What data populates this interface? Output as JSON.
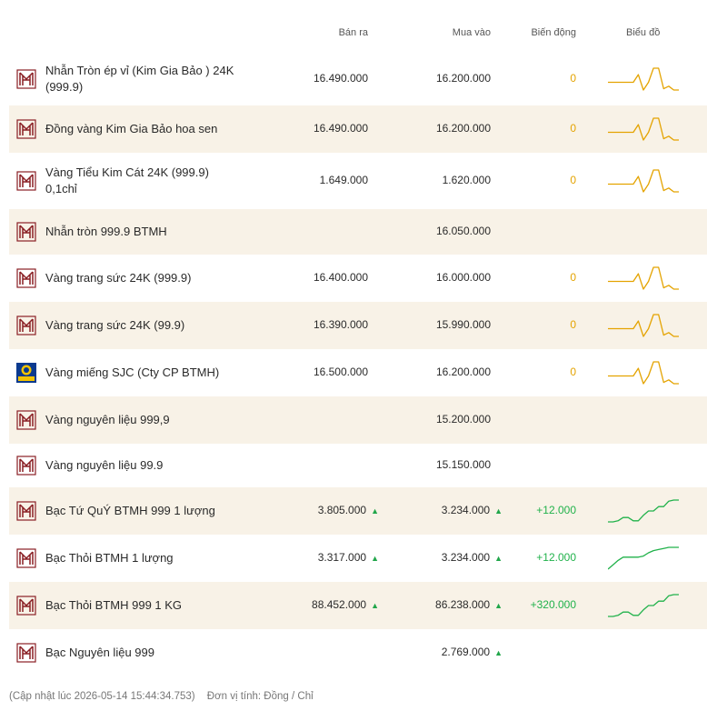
{
  "header": {
    "sell": "Bán ra",
    "buy": "Mua vào",
    "change": "Biến động",
    "chart": "Biểu đồ"
  },
  "colors": {
    "zero": "#e4a300",
    "positive": "#21b24b",
    "alt_row": "#f8f2e7",
    "brand": "#8a1f24"
  },
  "rows": [
    {
      "name": "Nhẫn Tròn ép vỉ (Kim Gia Bảo ) 24K (999.9)",
      "sell": "16.490.000",
      "buy": "16.200.000",
      "change": "0",
      "trend": "flat",
      "logo": "btmh-logo"
    },
    {
      "name": "Đồng vàng Kim Gia Bảo hoa sen",
      "sell": "16.490.000",
      "buy": "16.200.000",
      "change": "0",
      "trend": "flat",
      "logo": "btmh-logo"
    },
    {
      "name": "Vàng Tiểu Kim Cát 24K (999.9) 0,1chỉ",
      "sell": "1.649.000",
      "buy": "1.620.000",
      "change": "0",
      "trend": "flat",
      "logo": "btmh-logo"
    },
    {
      "name": "Nhẫn tròn 999.9 BTMH",
      "sell": "",
      "buy": "16.050.000",
      "change": "",
      "trend": "",
      "logo": "btmh-logo"
    },
    {
      "name": "Vàng trang sức 24K (999.9)",
      "sell": "16.400.000",
      "buy": "16.000.000",
      "change": "0",
      "trend": "flat",
      "logo": "btmh-logo"
    },
    {
      "name": "Vàng trang sức 24K (99.9)",
      "sell": "16.390.000",
      "buy": "15.990.000",
      "change": "0",
      "trend": "flat",
      "logo": "btmh-logo"
    },
    {
      "name": "Vàng miếng SJC (Cty CP BTMH)",
      "sell": "16.500.000",
      "buy": "16.200.000",
      "change": "0",
      "trend": "flat",
      "logo": "sjc-logo"
    },
    {
      "name": "Vàng nguyên liệu 999,9",
      "sell": "",
      "buy": "15.200.000",
      "change": "",
      "trend": "",
      "logo": "btmh-logo"
    },
    {
      "name": "Vàng nguyên liệu 99.9",
      "sell": "",
      "buy": "15.150.000",
      "change": "",
      "trend": "",
      "logo": "btmh-logo"
    },
    {
      "name": "Bạc Tứ QuÝ BTMH 999 1 lượng",
      "sell": "3.805.000",
      "buy": "3.234.000",
      "change": "+12.000",
      "trend": "up",
      "logo": "btmh-logo",
      "sell_up": true,
      "buy_up": true
    },
    {
      "name": "Bạc Thỏi BTMH 1 lượng",
      "sell": "3.317.000",
      "buy": "3.234.000",
      "change": "+12.000",
      "trend": "up2",
      "logo": "btmh-logo",
      "sell_up": true,
      "buy_up": true
    },
    {
      "name": "Bạc Thỏi BTMH 999 1 KG",
      "sell": "88.452.000",
      "buy": "86.238.000",
      "change": "+320.000",
      "trend": "up",
      "logo": "btmh-logo",
      "sell_up": true,
      "buy_up": true
    },
    {
      "name": "Bạc Nguyên liệu 999",
      "sell": "",
      "buy": "2.769.000",
      "change": "",
      "trend": "",
      "logo": "btmh-logo",
      "buy_up": true
    }
  ],
  "footer": {
    "updated": "(Cập nhật lúc 2026-05-14 15:44:34.753)",
    "unit": "Đơn vị tính: Đồng / Chỉ"
  }
}
